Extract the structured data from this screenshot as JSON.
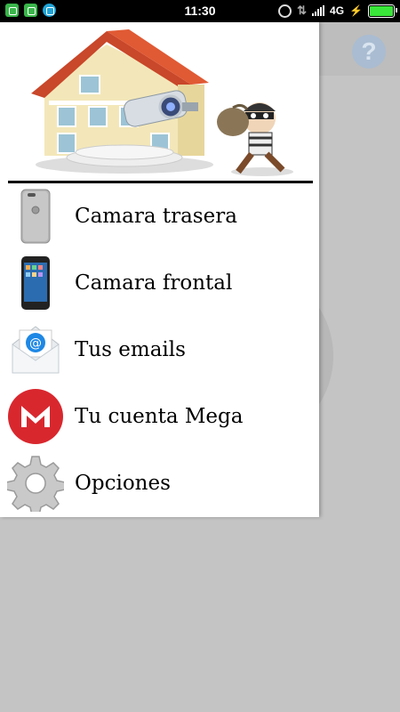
{
  "status_bar": {
    "time": "11:30",
    "network": "4G",
    "battery_level": 1.0
  },
  "app": {
    "help_label": "?"
  },
  "drawer": {
    "items": [
      {
        "label": "Camara trasera",
        "icon": "back-phone-icon"
      },
      {
        "label": "Camara frontal",
        "icon": "front-phone-icon"
      },
      {
        "label": "Tus emails",
        "icon": "email-envelope-icon"
      },
      {
        "label": "Tu cuenta Mega",
        "icon": "mega-logo-icon"
      },
      {
        "label": "Opciones",
        "icon": "gear-icon"
      }
    ]
  },
  "colors": {
    "mega_red": "#d9272e",
    "email_blue": "#1e88e5",
    "battery_green": "#39e639"
  }
}
